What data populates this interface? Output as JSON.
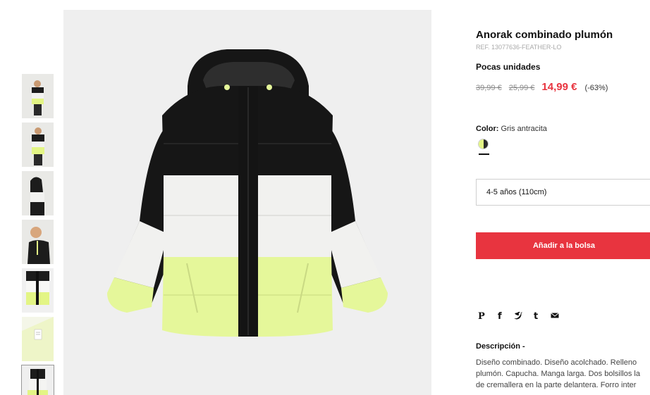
{
  "product": {
    "title": "Anorak combinado plumón",
    "ref": "REF. 13077636-FEATHER-LO",
    "stock": "Pocas unidades",
    "prices": {
      "original": "39,99 €",
      "previous": "25,99 €",
      "current": "14,99 €",
      "discount": "(-63%)"
    },
    "color": {
      "label": "Color:",
      "value": "Gris antracita",
      "swatch_colors": [
        "#e3f585",
        "#2b2b2b"
      ]
    },
    "size": "4-5 años (110cm)",
    "add_to_bag": "Añadir a la bolsa",
    "description": {
      "title": "Descripción -",
      "lines": [
        "Diseño combinado. Diseño acolchado. Relleno",
        "plumón. Capucha. Manga larga. Dos bolsillos la",
        "de cremallera en la parte delantera. Forro inter"
      ]
    }
  },
  "share_icons": [
    "pinterest-icon",
    "facebook-icon",
    "twitter-icon",
    "tumblr-icon",
    "email-icon"
  ],
  "share_glyphs": {
    "pinterest": "P",
    "facebook": "f",
    "tumblr": "t"
  },
  "thumbnails_count": 7,
  "colors": {
    "accent": "#e8343f",
    "background_image": "#efefef",
    "jacket_black": "#161616",
    "jacket_white": "#f1f1ef",
    "jacket_lime": "#e5f79a"
  }
}
